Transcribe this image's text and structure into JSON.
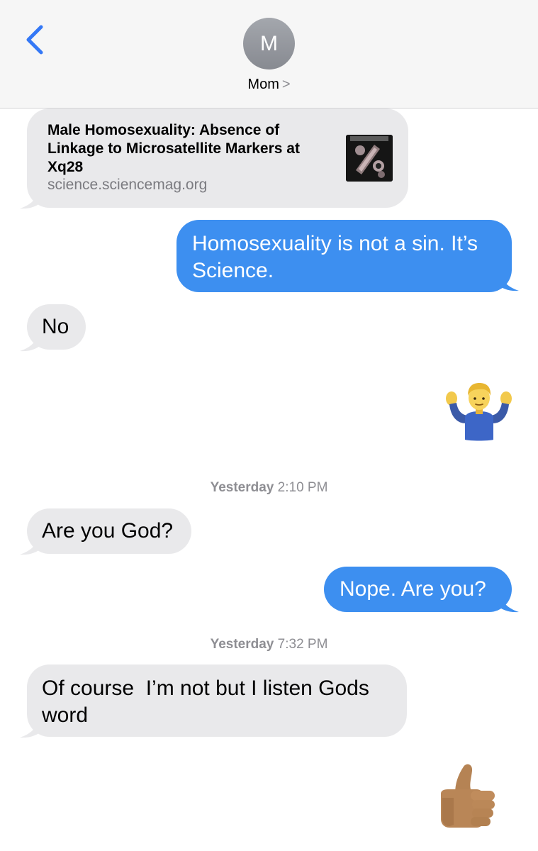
{
  "header": {
    "back_icon": "chevron-left-icon",
    "avatar_initial": "M",
    "contact_name": "Mom",
    "contact_chevron": ">"
  },
  "colors": {
    "accent": "#3d8ff0",
    "incoming_bubble": "#e9e9eb",
    "header_bg": "#f6f6f6"
  },
  "link_preview": {
    "title": "Male Homosexuality: Absence of Linkage to Microsatellite Markers at Xq28",
    "domain": "science.sciencemag.org",
    "thumbnail": "science-journal-cover-thumbnail"
  },
  "messages": [
    {
      "direction": "out",
      "text": "Homosexuality is not a sin. It’s Science."
    },
    {
      "direction": "in",
      "text": "No"
    },
    {
      "direction": "out",
      "emoji": "man-shrugging-emoji"
    },
    {
      "direction": "in",
      "text": "Are you God?"
    },
    {
      "direction": "out",
      "text": "Nope. Are you?"
    },
    {
      "direction": "in",
      "text": "Of course  I’m not but I listen Gods word"
    },
    {
      "direction": "out",
      "emoji": "thumbs-up-emoji"
    }
  ],
  "timestamps": [
    {
      "day": "Yesterday",
      "time": "2:10 PM"
    },
    {
      "day": "Yesterday",
      "time": "7:32 PM"
    }
  ]
}
